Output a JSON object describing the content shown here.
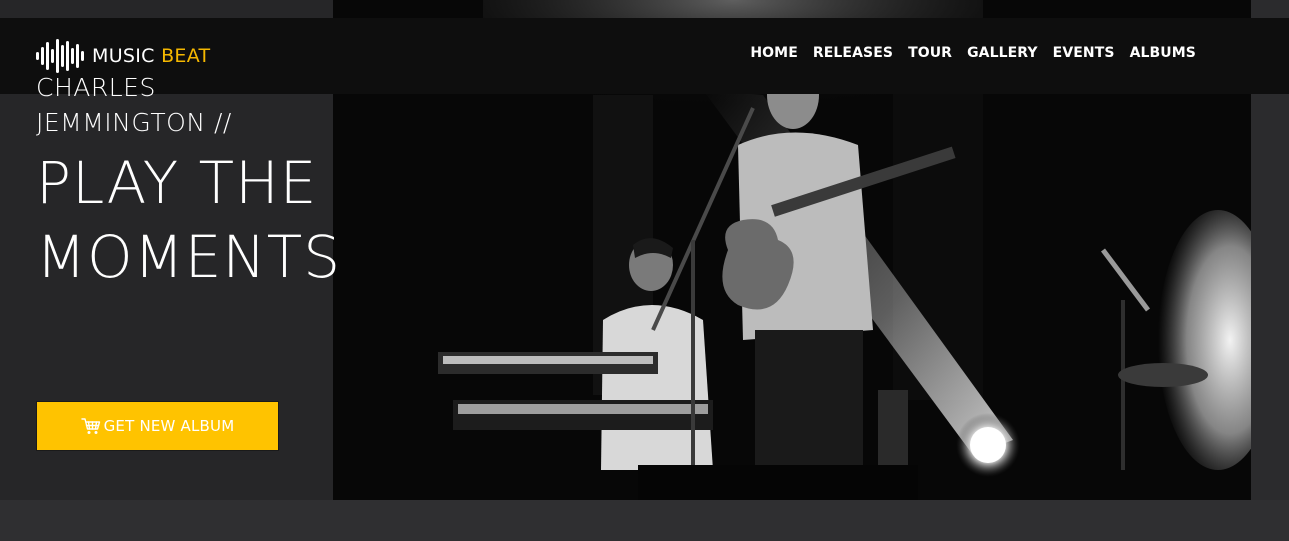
{
  "brand": {
    "name_primary": "MUSIC",
    "name_accent": "BEAT",
    "accent_color": "#f5b800",
    "icon": "soundwave-icon"
  },
  "nav": {
    "items": [
      {
        "label": "HOME"
      },
      {
        "label": "RELEASES"
      },
      {
        "label": "TOUR"
      },
      {
        "label": "GALLERY"
      },
      {
        "label": "EVENTS"
      },
      {
        "label": "ALBUMS"
      }
    ]
  },
  "hero": {
    "artist_line1": "CHARLES",
    "artist_line2": "JEMMINGTON //",
    "headline_line1": "PLAY THE",
    "headline_line2": "MOMENTS",
    "cta_label": "GET NEW ALBUM",
    "cta_icon": "cart-icon",
    "cta_color": "#ffc300"
  }
}
